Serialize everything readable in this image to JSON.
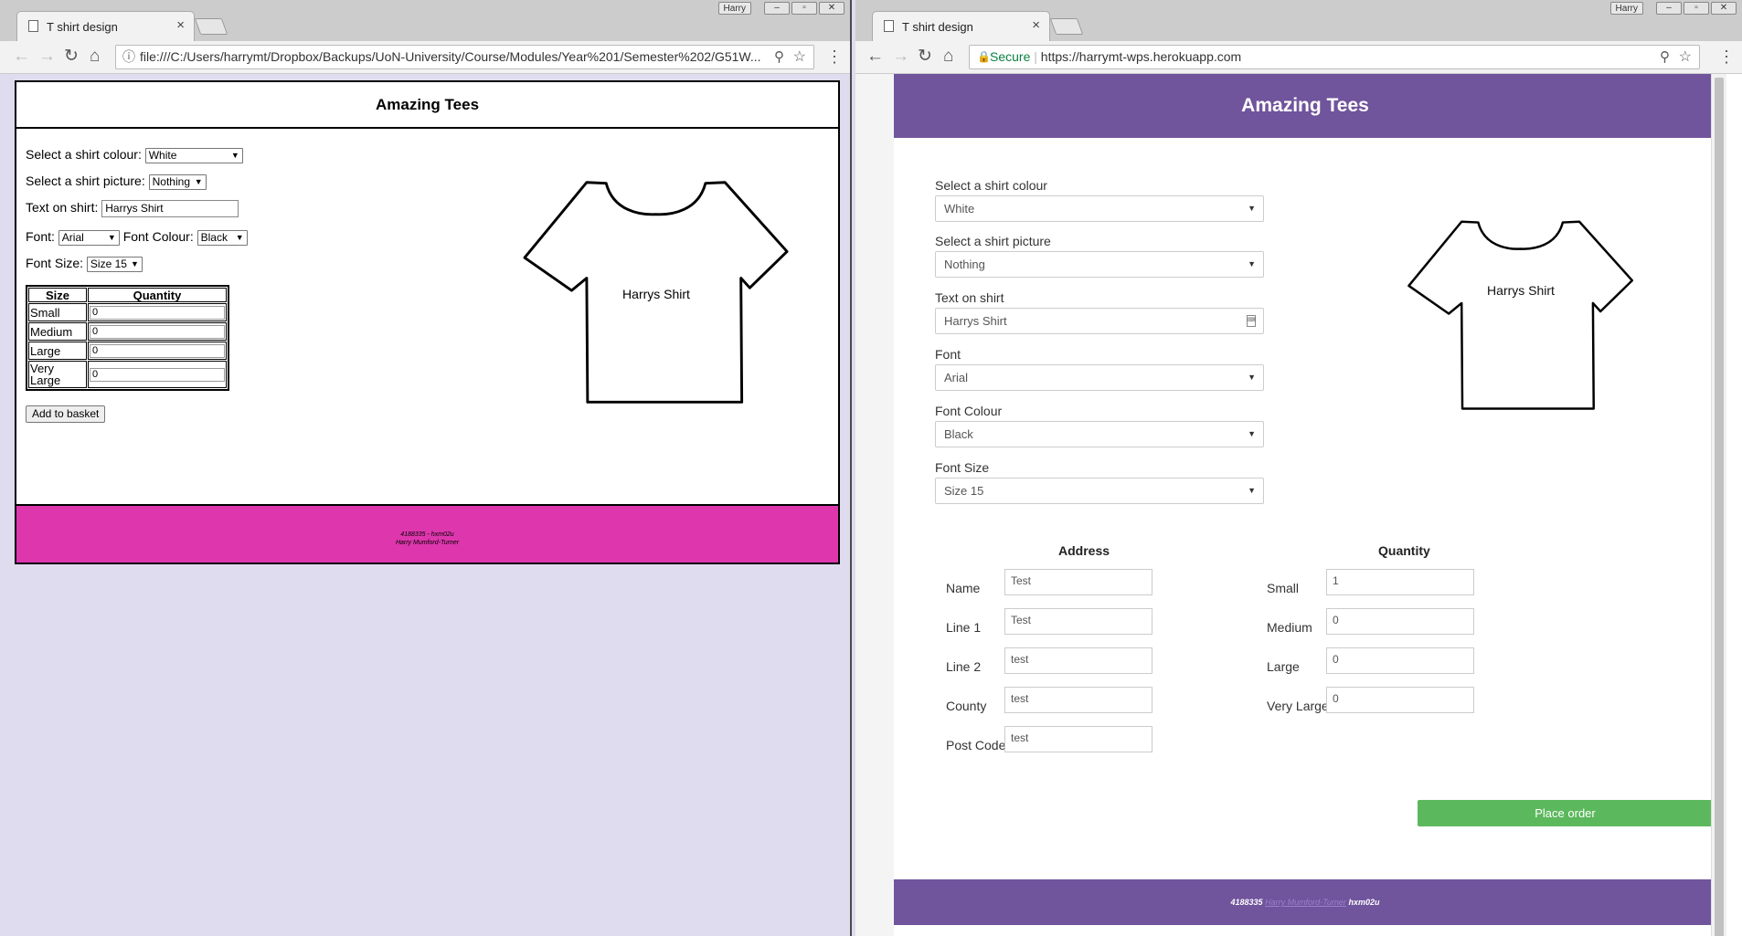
{
  "left_window": {
    "tab_title": "T shirt design",
    "tab_close": "×",
    "user_badge": "Harry",
    "window_buttons": [
      "–",
      "▫",
      "✕"
    ],
    "address": "file:///C:/Users/harrymt/Dropbox/Backups/UoN-University/Course/Modules/Year%201/Semester%202/G51W...",
    "page": {
      "header": "Amazing Tees",
      "colour_label": "Select a shirt colour:",
      "colour_value": "White",
      "picture_label": "Select a shirt picture:",
      "picture_value": "Nothing",
      "text_label": "Text on shirt:",
      "text_value": "Harrys Shirt",
      "font_label": "Font:",
      "font_value": "Arial",
      "font_colour_label": "Font Colour:",
      "font_colour_value": "Black",
      "font_size_label": "Font Size:",
      "font_size_value": "Size 15",
      "table_headers": [
        "Size",
        "Quantity"
      ],
      "sizes": [
        {
          "label": "Small",
          "qty": "0"
        },
        {
          "label": "Medium",
          "qty": "0"
        },
        {
          "label": "Large",
          "qty": "0"
        },
        {
          "label": "Very Large",
          "qty": "0"
        }
      ],
      "add_button": "Add to basket",
      "shirt_text": "Harrys Shirt",
      "footer_line1": "4188335 - hxm02u",
      "footer_line2": "Harry Mumford-Turner",
      "footer_color": "#de37ad"
    }
  },
  "right_window": {
    "tab_title": "T shirt design",
    "tab_close": "×",
    "user_badge": "Harry",
    "window_buttons": [
      "–",
      "▫",
      "✕"
    ],
    "secure_label": "Secure",
    "address": "https://harrymt-wps.herokuapp.com",
    "page": {
      "header": "Amazing Tees",
      "accent_color": "#70549c",
      "fields": [
        {
          "label": "Select a shirt colour",
          "value": "White"
        },
        {
          "label": "Select a shirt picture",
          "value": "Nothing"
        },
        {
          "label": "Text on shirt",
          "value": "Harrys Shirt"
        },
        {
          "label": "Font",
          "value": "Arial"
        },
        {
          "label": "Font Colour",
          "value": "Black"
        },
        {
          "label": "Font Size",
          "value": "Size 15"
        }
      ],
      "shirt_text": "Harrys Shirt",
      "address_heading": "Address",
      "address_fields": [
        {
          "label": "Name",
          "value": "Test"
        },
        {
          "label": "Line 1",
          "value": "Test"
        },
        {
          "label": "Line 2",
          "value": "test"
        },
        {
          "label": "County",
          "value": "test"
        },
        {
          "label": "Post Code",
          "value": "test"
        }
      ],
      "quantity_heading": "Quantity",
      "quantity_fields": [
        {
          "label": "Small",
          "value": "1"
        },
        {
          "label": "Medium",
          "value": "0"
        },
        {
          "label": "Large",
          "value": "0"
        },
        {
          "label": "Very Large",
          "value": "0"
        }
      ],
      "order_button": "Place order",
      "order_color": "#5cb85c",
      "footer_id": "4188335",
      "footer_name": "Harry Mumford-Turner",
      "footer_user": "hxm02u"
    }
  }
}
